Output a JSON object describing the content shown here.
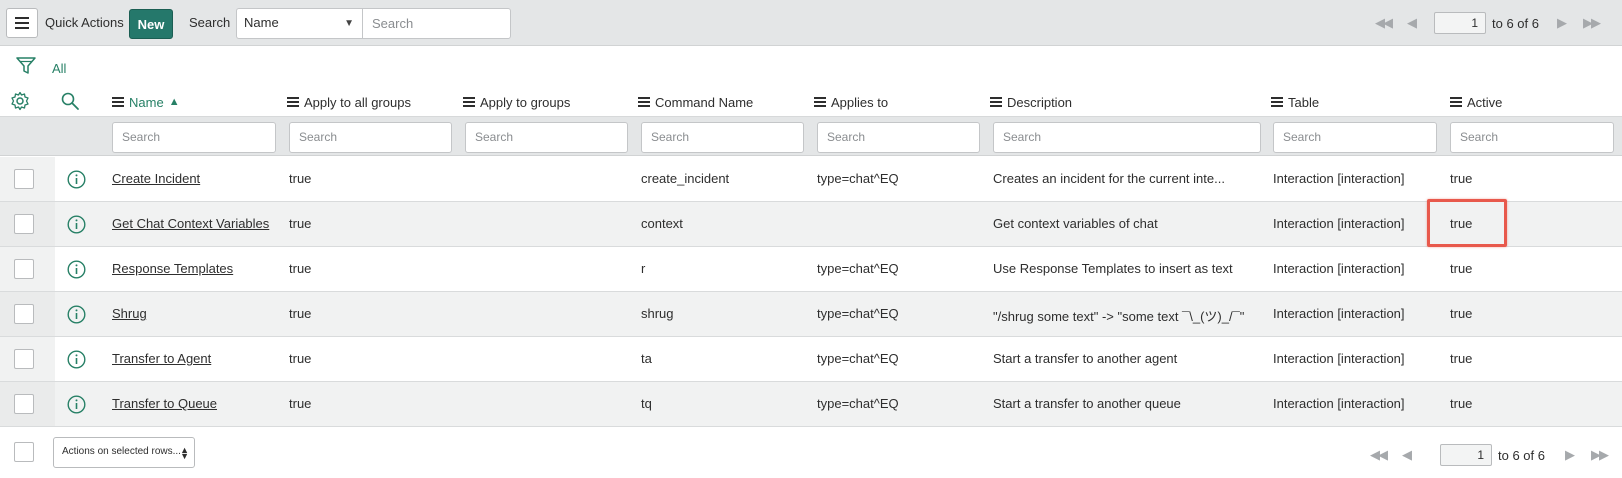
{
  "toolbar": {
    "quick_actions_label": "Quick Actions",
    "new_label": "New",
    "search_label": "Search",
    "search_field_value": "Name",
    "search_placeholder": "Search",
    "page_number": "1",
    "page_of": "to 6 of 6"
  },
  "filter": {
    "all_label": "All"
  },
  "columns": [
    {
      "label": "Name",
      "sort": "ascending"
    },
    {
      "label": "Apply to all groups"
    },
    {
      "label": "Apply to groups"
    },
    {
      "label": "Command Name"
    },
    {
      "label": "Applies to"
    },
    {
      "label": "Description"
    },
    {
      "label": "Table"
    },
    {
      "label": "Active"
    }
  ],
  "column_search_placeholder": "Search",
  "rows": [
    {
      "name": "Create Incident",
      "apply_all": "true",
      "apply_groups": "",
      "command": "create_incident",
      "applies_to": "type=chat^EQ",
      "description": "Creates an incident for the current inte...",
      "table": "Interaction [interaction]",
      "active": "true"
    },
    {
      "name": "Get Chat Context Variables",
      "apply_all": "true",
      "apply_groups": "",
      "command": "context",
      "applies_to": "",
      "description": "Get context variables of chat",
      "table": "Interaction [interaction]",
      "active": "true"
    },
    {
      "name": "Response Templates",
      "apply_all": "true",
      "apply_groups": "",
      "command": "r",
      "applies_to": "type=chat^EQ",
      "description": "Use Response Templates to insert as text",
      "table": "Interaction [interaction]",
      "active": "true"
    },
    {
      "name": "Shrug",
      "apply_all": "true",
      "apply_groups": "",
      "command": "shrug",
      "applies_to": "type=chat^EQ",
      "description": "\"/shrug some text\" -> \"some text ¯\\_(ツ)_/¯\"",
      "table": "Interaction [interaction]",
      "active": "true"
    },
    {
      "name": "Transfer to Agent",
      "apply_all": "true",
      "apply_groups": "",
      "command": "ta",
      "applies_to": "type=chat^EQ",
      "description": "Start a transfer to another agent",
      "table": "Interaction [interaction]",
      "active": "true"
    },
    {
      "name": "Transfer to Queue",
      "apply_all": "true",
      "apply_groups": "",
      "command": "tq",
      "applies_to": "type=chat^EQ",
      "description": "Start a transfer to another queue",
      "table": "Interaction [interaction]",
      "active": "true"
    }
  ],
  "footer": {
    "actions_label": "Actions on selected rows...",
    "page_number": "1",
    "page_of": "to 6 of 6"
  },
  "colors": {
    "accent": "#278066",
    "new_button": "#25786b",
    "highlight": "#e8594c",
    "header_bg": "#e4e6e7"
  }
}
